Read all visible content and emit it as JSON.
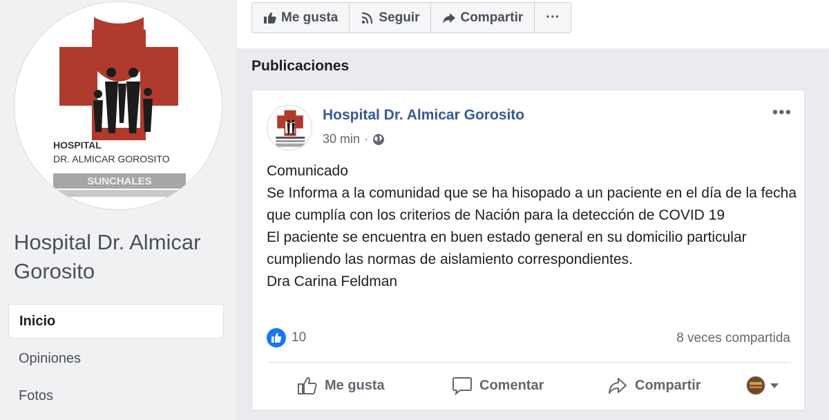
{
  "page": {
    "name": "Hospital Dr. Almicar Gorosito",
    "logo_text": {
      "line1": "HOSPITAL",
      "line2": "DR. ALMICAR GOROSITO",
      "line3": "SUNCHALES"
    }
  },
  "nav": {
    "items": [
      {
        "label": "Inicio",
        "active": true
      },
      {
        "label": "Opiniones",
        "active": false
      },
      {
        "label": "Fotos",
        "active": false
      }
    ]
  },
  "actions": {
    "like_label": "Me gusta",
    "follow_label": "Seguir",
    "share_label": "Compartir",
    "more_label": "···"
  },
  "section_title": "Publicaciones",
  "post": {
    "author": "Hospital Dr. Almicar Gorosito",
    "time": "30 min",
    "separator": "·",
    "menu": "•••",
    "body": [
      "Comunicado",
      "Se Informa a la comunidad que se ha hisopado a un paciente en el día de la fecha que cumplía con los criterios de Nación para la detección de COVID 19",
      "El paciente se encuentra en buen estado general en su domicilio particular cumpliendo las normas de aislamiento correspondientes.",
      "Dra Carina Feldman"
    ],
    "reaction_count": "10",
    "shares": "8 veces compartida",
    "buttons": {
      "like": "Me gusta",
      "comment": "Comentar",
      "share": "Compartir"
    }
  },
  "colors": {
    "brand_red": "#b03a2e",
    "link_blue": "#385898",
    "like_blue": "#1877f2"
  }
}
